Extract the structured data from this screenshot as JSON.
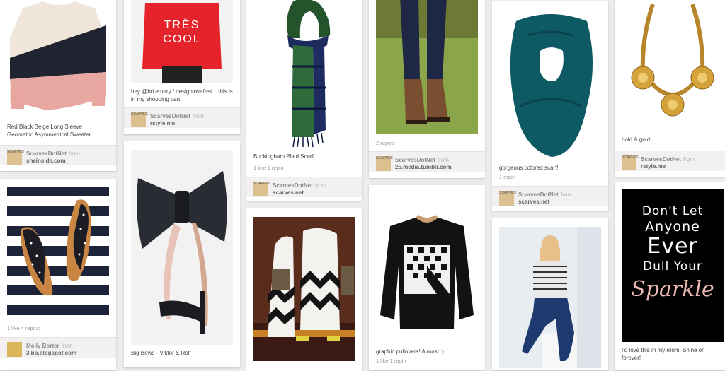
{
  "pins": [
    {
      "description": "Red Black Beige Long Sleeve Geometric Asymmetrical Sweater",
      "stats": "",
      "user": "ScarvesDotNet",
      "from_label": "from",
      "source": "sheinside.com"
    },
    {
      "description": "",
      "stats": "1 like    4 repins",
      "user": "Molly Borter",
      "from_label": "from",
      "source": "3.bp.blogspot.com"
    },
    {
      "description": "hey @bri emery / designlovefest... this is in my shopping cart.",
      "stats": "",
      "user": "ScarvesDotNet",
      "from_label": "from",
      "source": "rstyle.me"
    },
    {
      "description": "Big Bows - Viktor & Rolf",
      "stats": ""
    },
    {
      "description": "Buckingham Plaid Scarf",
      "stats": "1 like    1 repin",
      "user": "ScarvesDotNet",
      "from_label": "from",
      "source": "scarves.net"
    },
    {
      "description": "",
      "stats": ""
    },
    {
      "description": "",
      "stats": "2 repins",
      "user": "ScarvesDotNet",
      "from_label": "from",
      "source": "25.media.tumblr.com"
    },
    {
      "description": "graphic pullovers! A must :)",
      "stats": "1 like    1 repin"
    },
    {
      "description": "gorgeous colored scarf!",
      "stats": "1 repin",
      "user": "ScarvesDotNet",
      "from_label": "from",
      "source": "scarves.net"
    },
    {
      "description": "",
      "stats": ""
    },
    {
      "description": "bold & gold",
      "stats": "",
      "user": "ScarvesDotNet",
      "from_label": "from",
      "source": "rstyle.me"
    },
    {
      "description": "I'd love this in my room. Shine on forever!",
      "stats": "",
      "poster_lines": [
        "Don't Let",
        "Anyone",
        "Ever",
        "Dull Your"
      ],
      "poster_script": "Sparkle"
    }
  ],
  "avatar_text": "SCARVES"
}
